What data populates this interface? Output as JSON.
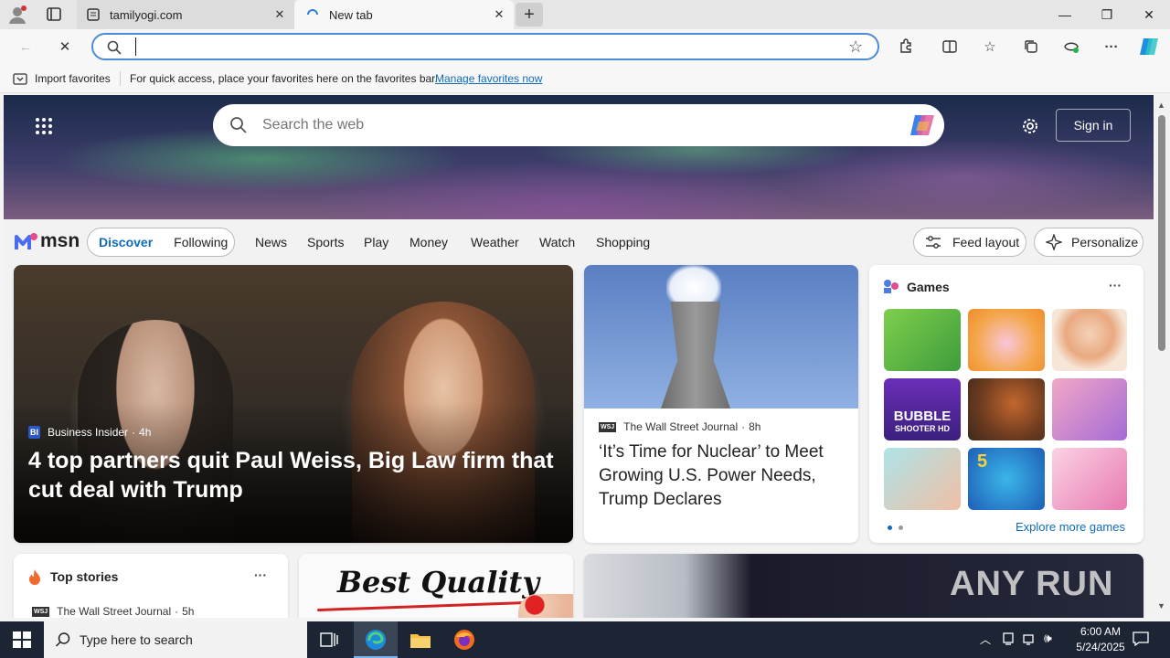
{
  "tabs": [
    {
      "title": "tamilyogi.com",
      "active": false
    },
    {
      "title": "New tab",
      "active": true
    }
  ],
  "address_bar": {
    "value": "",
    "placeholder": ""
  },
  "favorites_bar": {
    "import_label": "Import favorites",
    "message": "For quick access, place your favorites here on the favorites bar.",
    "manage_link": "Manage favorites now"
  },
  "msn": {
    "search_placeholder": "Search the web",
    "sign_in": "Sign in",
    "logo_text": "msn",
    "feed_tabs": [
      "Discover",
      "Following"
    ],
    "nav_links": [
      "News",
      "Sports",
      "Play",
      "Money",
      "Weather",
      "Watch",
      "Shopping"
    ],
    "feed_layout": "Feed layout",
    "personalize": "Personalize",
    "hero_story": {
      "source_badge": "BI",
      "source": "Business Insider",
      "age": "4h",
      "headline": "4 top partners quit Paul Weiss, Big Law firm that cut deal with Trump"
    },
    "side_story": {
      "source_badge": "WSJ",
      "source": "The Wall Street Journal",
      "age": "8h",
      "headline": "‘It’s Time for Nuclear’ to Meet Growing U.S. Power Needs, Trump Declares"
    },
    "games": {
      "title": "Games",
      "more": "···",
      "explore": "Explore more games",
      "tile_labels": [
        "BUBBLE",
        "SHOOTER HD",
        "5"
      ]
    },
    "top_stories": {
      "title": "Top stories",
      "more": "···",
      "source_badge": "WSJ",
      "source": "The Wall Street Journal",
      "age": "5h"
    },
    "ad_text": "Best Quality",
    "watermark": "ANY RUN"
  },
  "taskbar": {
    "search_placeholder": "Type here to search",
    "time": "6:00 AM",
    "date": "5/24/2025"
  },
  "colors": {
    "accent": "#0f6cbd",
    "taskbar": "#1c2533",
    "link": "#0f6cbd"
  }
}
